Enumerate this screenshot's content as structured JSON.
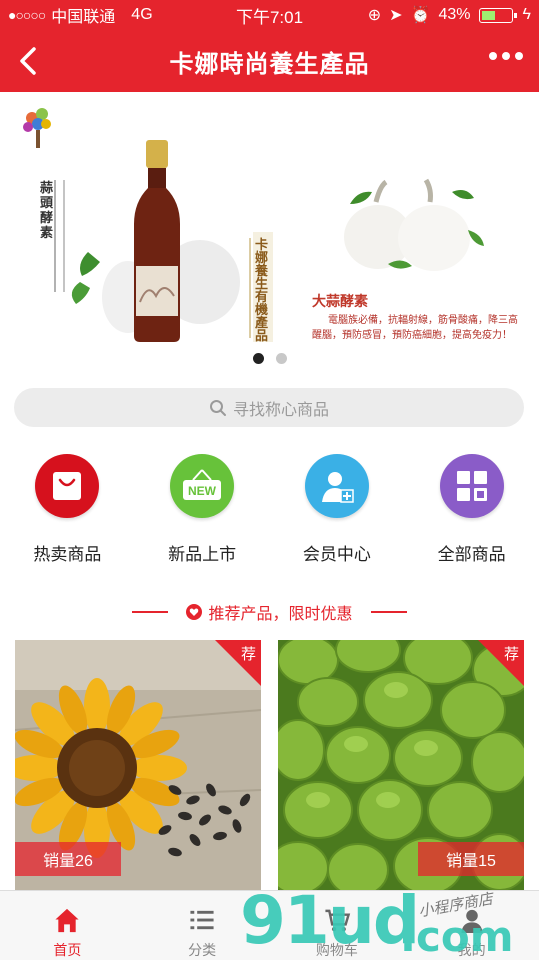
{
  "status_bar": {
    "carrier": "中国联通",
    "network": "4G",
    "time": "下午7:01",
    "battery": "43%",
    "battery_level": 0.43
  },
  "navbar": {
    "title": "卡娜時尚養生產品",
    "back_icon": "chevron-left-icon",
    "more_icon": "more-dots-icon"
  },
  "banner": {
    "left_vertical_text": "蒜頭酵素",
    "bottle_label": "卡娜養生有機產品",
    "right_title": "大蒜酵素",
    "right_desc_1": "電腦族必備，抗輻射線，筋骨酸痛，降三高",
    "right_desc_2": "醒腦，預防感冒，預防癌細胞，提高免疫力！",
    "slide_count": 2,
    "active_slide": 1
  },
  "search": {
    "placeholder": "寻找称心商品",
    "icon": "search-icon"
  },
  "categories": [
    {
      "label": "热卖商品",
      "icon": "shopping-bag-icon",
      "color": "#d6111d"
    },
    {
      "label": "新品上市",
      "icon": "new-badge-icon",
      "color": "#67c23a"
    },
    {
      "label": "会员中心",
      "icon": "member-icon",
      "color": "#3ab0e6"
    },
    {
      "label": "全部商品",
      "icon": "grid-icon",
      "color": "#8a5cc8"
    }
  ],
  "recommend": {
    "title": "推荐产品，限时优惠",
    "icon": "heart-icon"
  },
  "products": [
    {
      "tag": "荐",
      "sales": "销量26",
      "image": "sunflower-seeds"
    },
    {
      "tag": "荐",
      "sales": "销量15",
      "image": "green-olives"
    }
  ],
  "tabbar": [
    {
      "label": "首页",
      "icon": "home-icon",
      "active": true
    },
    {
      "label": "分类",
      "icon": "list-icon",
      "active": false
    },
    {
      "label": "购物车",
      "icon": "cart-icon",
      "active": false
    },
    {
      "label": "我的",
      "icon": "user-icon",
      "active": false
    }
  ],
  "watermark": {
    "big": "91ud",
    "dotcom": ".com",
    "cursive": "小程序商店"
  },
  "colors": {
    "brand": "#e5242d"
  }
}
